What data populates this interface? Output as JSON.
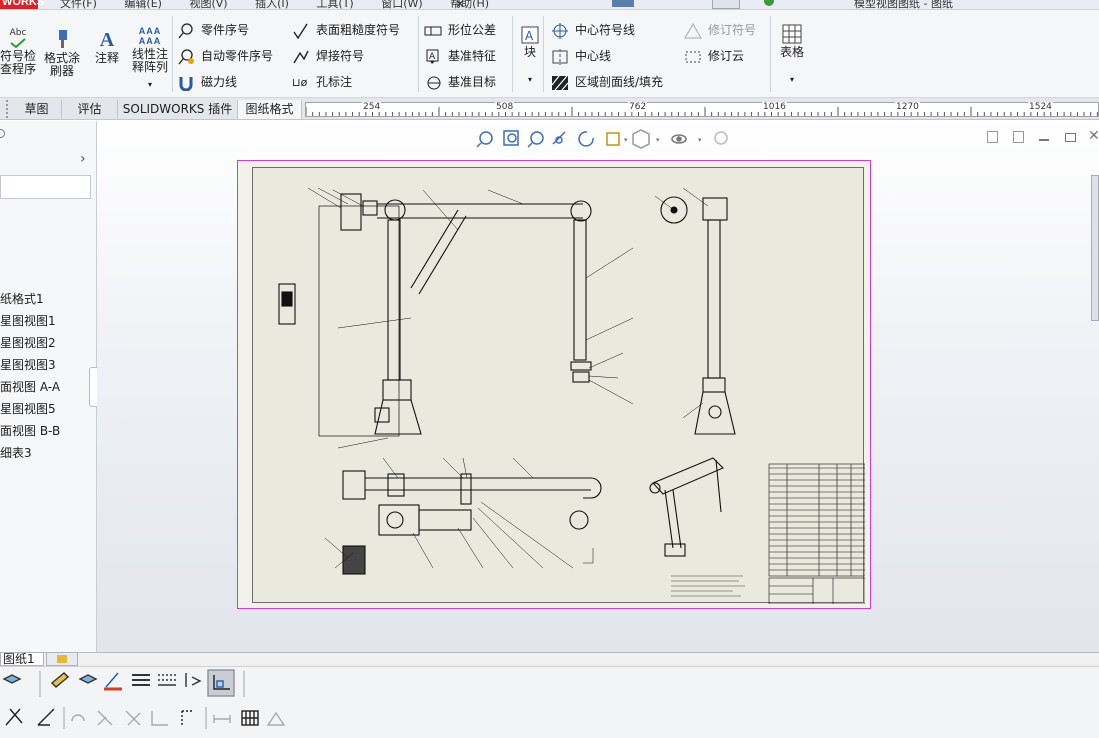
{
  "app": {
    "brand": "WORKS"
  },
  "menu_fragments": [
    "文件(F)",
    "编辑(E)",
    "视图(V)",
    "插入(I)",
    "工具(T)",
    "窗口(W)",
    "帮助(H)"
  ],
  "window_title_fragment": "模型视图图纸 - 图纸",
  "ribbon": {
    "col1": {
      "label": "符号检查程序",
      "label_lines": [
        "符号检",
        "查程序"
      ],
      "abc": "Abc"
    },
    "col2": {
      "label_lines": [
        "格式涂",
        "刷器"
      ]
    },
    "annotation": {
      "label": "注释"
    },
    "linear_note": {
      "label_lines": [
        "线性注",
        "释阵列"
      ]
    },
    "group1": [
      "零件序号",
      "自动零件序号",
      "磁力线"
    ],
    "group2": [
      "表面粗糙度符号",
      "焊接符号",
      "孔标注"
    ],
    "group3": [
      "形位公差",
      "基准特征",
      "基准目标"
    ],
    "block": {
      "label": "块"
    },
    "group4": [
      "中心符号线",
      "中心线",
      "区域剖面线/填充"
    ],
    "group5": [
      "修订符号",
      "修订云"
    ],
    "table": {
      "label": "表格"
    }
  },
  "tabs": [
    "草图",
    "评估",
    "SOLIDWORKS 插件",
    "图纸格式"
  ],
  "ruler": {
    "ticks": [
      "254",
      "508",
      "762",
      "1016",
      "1270",
      "1524"
    ]
  },
  "tree": {
    "items": [
      "纸格式1",
      "星图视图1",
      "星图视图2",
      "星图视图3",
      "面视图 A-A",
      "星图视图5",
      "面视图 B-B",
      "细表3"
    ]
  },
  "sheet_tab": {
    "label": "图纸1"
  },
  "colors": {
    "sheet_border": "#d23bd2",
    "brand": "#d8232a",
    "paper": "#e9e9dd"
  }
}
